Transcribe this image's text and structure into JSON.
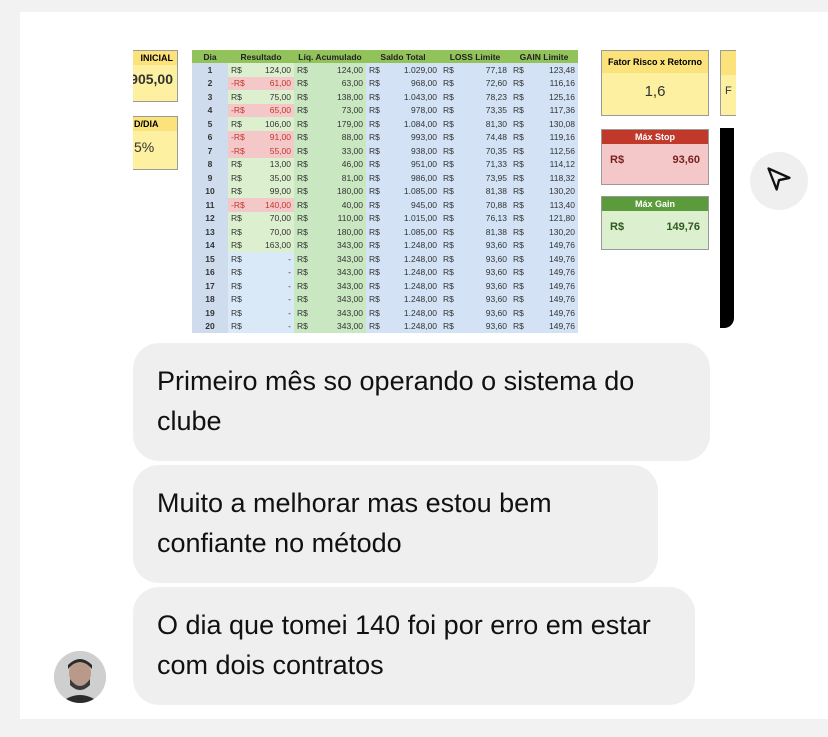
{
  "sheet": {
    "left_cards": {
      "inicial_title": "INICIAL",
      "inicial_value": "905,00",
      "dia_title": "D/DIA",
      "dia_value": "5%"
    },
    "columns": [
      "Dia",
      "Resultado",
      "Líq. Acumulado",
      "Saldo Total",
      "LOSS Limite",
      "GAIN Limite"
    ],
    "currency": "R$",
    "rows": [
      {
        "dia": "1",
        "res": "124,00",
        "neg": false,
        "liq": "124,00",
        "sal": "1.029,00",
        "loss": "77,18",
        "gain": "123,48"
      },
      {
        "dia": "2",
        "res": "61,00",
        "neg": true,
        "liq": "63,00",
        "sal": "968,00",
        "loss": "72,60",
        "gain": "116,16"
      },
      {
        "dia": "3",
        "res": "75,00",
        "neg": false,
        "liq": "138,00",
        "sal": "1.043,00",
        "loss": "78,23",
        "gain": "125,16"
      },
      {
        "dia": "4",
        "res": "65,00",
        "neg": true,
        "liq": "73,00",
        "sal": "978,00",
        "loss": "73,35",
        "gain": "117,36"
      },
      {
        "dia": "5",
        "res": "106,00",
        "neg": false,
        "liq": "179,00",
        "sal": "1.084,00",
        "loss": "81,30",
        "gain": "130,08"
      },
      {
        "dia": "6",
        "res": "91,00",
        "neg": true,
        "liq": "88,00",
        "sal": "993,00",
        "loss": "74,48",
        "gain": "119,16"
      },
      {
        "dia": "7",
        "res": "55,00",
        "neg": true,
        "liq": "33,00",
        "sal": "938,00",
        "loss": "70,35",
        "gain": "112,56"
      },
      {
        "dia": "8",
        "res": "13,00",
        "neg": false,
        "liq": "46,00",
        "sal": "951,00",
        "loss": "71,33",
        "gain": "114,12"
      },
      {
        "dia": "9",
        "res": "35,00",
        "neg": false,
        "liq": "81,00",
        "sal": "986,00",
        "loss": "73,95",
        "gain": "118,32"
      },
      {
        "dia": "10",
        "res": "99,00",
        "neg": false,
        "liq": "180,00",
        "sal": "1.085,00",
        "loss": "81,38",
        "gain": "130,20"
      },
      {
        "dia": "11",
        "res": "140,00",
        "neg": true,
        "liq": "40,00",
        "sal": "945,00",
        "loss": "70,88",
        "gain": "113,40"
      },
      {
        "dia": "12",
        "res": "70,00",
        "neg": false,
        "liq": "110,00",
        "sal": "1.015,00",
        "loss": "76,13",
        "gain": "121,80"
      },
      {
        "dia": "13",
        "res": "70,00",
        "neg": false,
        "liq": "180,00",
        "sal": "1.085,00",
        "loss": "81,38",
        "gain": "130,20"
      },
      {
        "dia": "14",
        "res": "163,00",
        "neg": false,
        "liq": "343,00",
        "sal": "1.248,00",
        "loss": "93,60",
        "gain": "149,76"
      },
      {
        "dia": "15",
        "res": "-",
        "neg": false,
        "liq": "343,00",
        "sal": "1.248,00",
        "loss": "93,60",
        "gain": "149,76"
      },
      {
        "dia": "16",
        "res": "-",
        "neg": false,
        "liq": "343,00",
        "sal": "1.248,00",
        "loss": "93,60",
        "gain": "149,76"
      },
      {
        "dia": "17",
        "res": "-",
        "neg": false,
        "liq": "343,00",
        "sal": "1.248,00",
        "loss": "93,60",
        "gain": "149,76"
      },
      {
        "dia": "18",
        "res": "-",
        "neg": false,
        "liq": "343,00",
        "sal": "1.248,00",
        "loss": "93,60",
        "gain": "149,76"
      },
      {
        "dia": "19",
        "res": "-",
        "neg": false,
        "liq": "343,00",
        "sal": "1.248,00",
        "loss": "93,60",
        "gain": "149,76"
      },
      {
        "dia": "20",
        "res": "-",
        "neg": false,
        "liq": "343,00",
        "sal": "1.248,00",
        "loss": "93,60",
        "gain": "149,76"
      }
    ],
    "right_cards": {
      "fator_title": "Fator Risco x Retorno",
      "fator_value": "1,6",
      "stop_title": "Máx Stop",
      "stop_currency": "R$",
      "stop_value": "93,60",
      "gain_title": "Máx Gain",
      "gain_currency": "R$",
      "gain_value": "149,76",
      "partial_letter": "F"
    }
  },
  "messages": [
    {
      "text": "Primeiro mês so operando o sistema do clube"
    },
    {
      "text": "Muito a melhorar mas estou bem confiante no método"
    },
    {
      "text": "O dia que tomei 140 foi por erro em estar com dois contratos"
    }
  ],
  "icons": {
    "send": "send-icon",
    "avatar": "avatar"
  },
  "colors": {
    "bubble": "#efefef",
    "header_green": "#92c35b",
    "card_yellow": "#fdf0a0",
    "card_red": "#f4c7c9",
    "card_green": "#dcefcf",
    "negative_text": "#c0392b"
  }
}
